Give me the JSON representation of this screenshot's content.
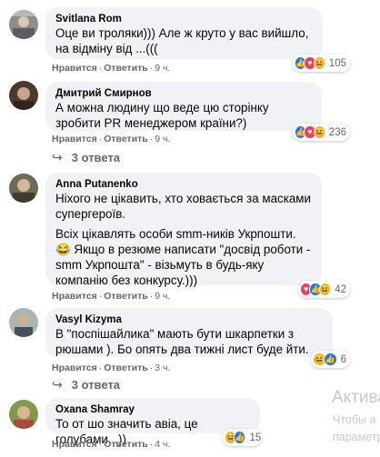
{
  "comments": [
    {
      "author": "Svitlana Rom",
      "text": [
        "Оце ви троляки))) Але ж круто у вас вийшло, на відміну від ...((("
      ],
      "like_label": "Нравится",
      "reply_label": "Ответить",
      "time": "9 ч.",
      "reaction_icons": [
        "like-icon",
        "love-icon",
        "haha-icon"
      ],
      "reaction_count": "105"
    },
    {
      "author": "Дмитрий Смирнов",
      "text": [
        "А можна людину що веде цю сторінку зробити PR менеджером країни?)"
      ],
      "like_label": "Нравится",
      "reply_label": "Ответить",
      "time": "9 ч.",
      "reaction_icons": [
        "like-icon",
        "love-icon",
        "haha-icon"
      ],
      "reaction_count": "236",
      "replies": "3 ответа"
    },
    {
      "author": "Anna Putanenko",
      "text": [
        "Ніхого не цікавить, хто ховається за масками супергероїв.",
        "Всіх цікавлять особи smm-ників Укрпошти. 😂 Якщо в резюме написати \"досвід роботи - smm Укрпошта\" - візьмуть в будь-яку компанію без конкурсу.)))"
      ],
      "like_label": "Нравится",
      "reply_label": "Ответить",
      "time": "9 ч.",
      "reaction_icons": [
        "love-icon",
        "like-icon",
        "haha-icon"
      ],
      "reaction_count": "42"
    },
    {
      "author": "Vasyl Kizyma",
      "text": [
        "В \"поспішайлика\" мають бути шкарпетки з рюшами ). Бо опять два тижні лист буде йти."
      ],
      "like_label": "Нравится",
      "reply_label": "Ответить",
      "time": "3 ч.",
      "reaction_icons": [
        "haha-icon",
        "like-icon"
      ],
      "reaction_count": "6",
      "replies": "3 ответа"
    },
    {
      "author": "Oxana Shamray",
      "text": [
        "То от шо значить авіа, це голубами...))"
      ],
      "like_label": "Нравится",
      "reply_label": "Ответить",
      "time": "4 ч.",
      "reaction_icons": [
        "haha-icon",
        "like-icon"
      ],
      "reaction_count": "15"
    }
  ],
  "watermark": {
    "line1": "Актива",
    "line2": "Чтобы а",
    "line3": "параметр"
  }
}
